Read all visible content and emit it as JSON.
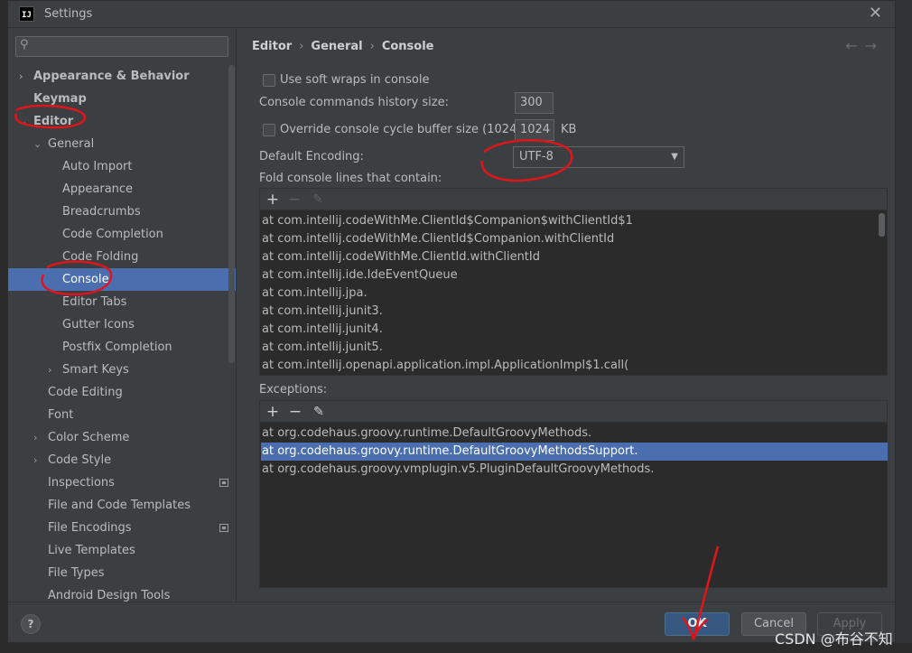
{
  "window": {
    "title": "Settings",
    "app_icon": "IJ"
  },
  "search": {
    "value": ""
  },
  "tree": [
    {
      "label": "Appearance & Behavior",
      "arrow": "›",
      "bold": true
    },
    {
      "label": "Keymap",
      "bold": true
    },
    {
      "label": "Editor",
      "arrow": "⌄",
      "bold": true
    },
    {
      "label": "General",
      "arrow": "⌄"
    },
    {
      "label": "Auto Import"
    },
    {
      "label": "Appearance"
    },
    {
      "label": "Breadcrumbs"
    },
    {
      "label": "Code Completion"
    },
    {
      "label": "Code Folding"
    },
    {
      "label": "Console",
      "selected": true
    },
    {
      "label": "Editor Tabs"
    },
    {
      "label": "Gutter Icons"
    },
    {
      "label": "Postfix Completion"
    },
    {
      "label": "Smart Keys",
      "arrow": "›"
    },
    {
      "label": "Code Editing"
    },
    {
      "label": "Font"
    },
    {
      "label": "Color Scheme",
      "arrow": "›"
    },
    {
      "label": "Code Style",
      "arrow": "›"
    },
    {
      "label": "Inspections",
      "badge": true
    },
    {
      "label": "File and Code Templates"
    },
    {
      "label": "File Encodings",
      "badge": true
    },
    {
      "label": "Live Templates"
    },
    {
      "label": "File Types"
    },
    {
      "label": "Android Design Tools"
    }
  ],
  "breadcrumb": [
    "Editor",
    "General",
    "Console"
  ],
  "nav": {
    "back": "←",
    "forward": "→"
  },
  "settings": {
    "soft_wraps_label": "Use soft wraps in console",
    "history_label": "Console commands history size:",
    "history_value": "300",
    "override_label": "Override console cycle buffer size (1024 KB)",
    "override_value": "1024",
    "override_unit": "KB",
    "encoding_label": "Default Encoding:",
    "encoding_value": "UTF-8",
    "fold_label": "Fold console lines that contain:",
    "exceptions_label": "Exceptions:"
  },
  "fold_lines": [
    "at com.intellij.codeWithMe.ClientId$Companion$withClientId$1",
    "at com.intellij.codeWithMe.ClientId$Companion.withClientId",
    "at com.intellij.codeWithMe.ClientId.withClientId",
    "at com.intellij.ide.IdeEventQueue",
    "at com.intellij.jpa.",
    "at com.intellij.junit3.",
    "at com.intellij.junit4.",
    "at com.intellij.junit5.",
    "at com.intellij.openapi.application.impl.ApplicationImpl$1.call("
  ],
  "exceptions": [
    {
      "text": "at org.codehaus.groovy.runtime.DefaultGroovyMethods."
    },
    {
      "text": "at org.codehaus.groovy.runtime.DefaultGroovyMethodsSupport.",
      "selected": true
    },
    {
      "text": "at org.codehaus.groovy.vmplugin.v5.PluginDefaultGroovyMethods."
    }
  ],
  "toolbar": {
    "add": "+",
    "remove": "−",
    "edit": "✎"
  },
  "footer": {
    "help": "?",
    "ok": "OK",
    "cancel": "Cancel",
    "apply": "Apply"
  },
  "watermark": "CSDN @布谷不知",
  "colors": {
    "selection": "#4b6eaf",
    "annotation": "#e0151b",
    "ok_button": "#365880"
  }
}
